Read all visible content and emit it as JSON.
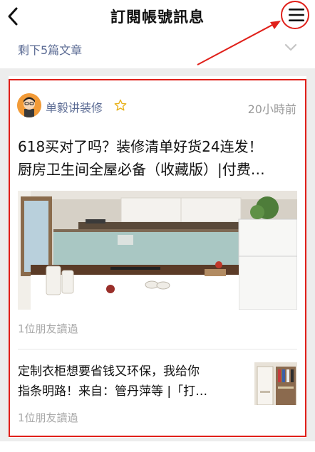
{
  "nav": {
    "title": "訂閱帳號訊息",
    "back_icon": "chevron-left-icon",
    "menu_icon": "hamburger-menu-icon"
  },
  "remaining": {
    "label": "剩下5篇文章",
    "expand_icon": "chevron-down-icon"
  },
  "article_card": {
    "account_name": "单毅讲装修",
    "badge_icon": "star-outline-icon",
    "time": "20小時前",
    "headline_line1": "618买对了吗？装修清单好货24连发！",
    "headline_line2": "厨房卫生间全屋必备（收藏版）|付费…",
    "cover_image": "kitchen-interior-photo",
    "cover_readers": "1位朋友讀過",
    "sub_article": {
      "title_line1": "定制衣柜想要省钱又环保，我给你",
      "title_line2": "指条明路！来自：管丹萍等 |「打…",
      "thumbnail": "closet-interior-photo",
      "readers": "1位朋友讀過"
    }
  },
  "colors": {
    "annotation_red": "#e0201a",
    "link_blue": "#5a6a93",
    "meta_gray": "#9a9a9a",
    "page_bg": "#ededed"
  }
}
